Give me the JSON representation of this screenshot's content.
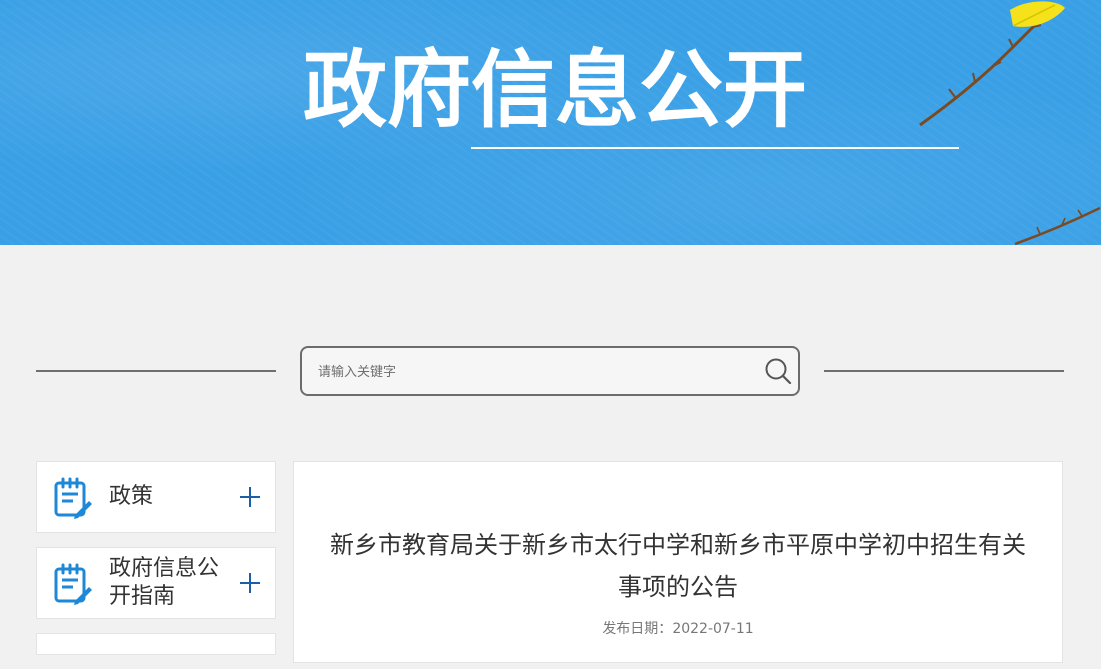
{
  "banner": {
    "title": "政府信息公开"
  },
  "search": {
    "placeholder": "请输入关键字"
  },
  "sidebar": {
    "items": [
      {
        "label": "政策",
        "icon": "document-edit-icon"
      },
      {
        "label": "政府信息公开指南",
        "icon": "document-edit-icon"
      },
      {
        "label": "",
        "icon": ""
      }
    ]
  },
  "article": {
    "title": "新乡市教育局关于新乡市太行中学和新乡市平原中学初中招生有关事项的公告",
    "date_label": "发布日期：",
    "date": "2022-07-11"
  },
  "colors": {
    "banner": "#3aa0e6",
    "accent": "#1e88d6",
    "plus": "#1b5fa8"
  }
}
